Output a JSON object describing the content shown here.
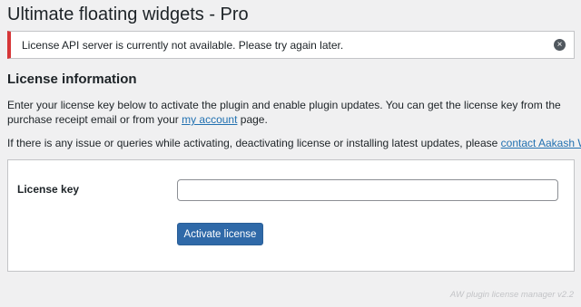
{
  "page": {
    "title": "Ultimate floating widgets - Pro"
  },
  "notice": {
    "message": "License API server is currently not available. Please try again later.",
    "dismiss_icon": "×"
  },
  "license": {
    "heading": "License information",
    "intro_before": "Enter your license key below to activate the plugin and enable plugin updates. You can get the license key from the purchase receipt email or from your ",
    "account_link": "my account",
    "intro_after": " page.",
    "issue_before": "If there is any issue or queries while activating, deactivating license or installing latest updates, please ",
    "contact_link": "contact Aakash Web",
    "key_label": "License key",
    "key_value": "",
    "key_placeholder": "",
    "activate_button": "Activate license"
  },
  "footer": {
    "text": "AW plugin license manager v2.2"
  },
  "colors": {
    "error_accent": "#d63638",
    "link": "#2271b1",
    "primary_button": "#2f69a8"
  }
}
